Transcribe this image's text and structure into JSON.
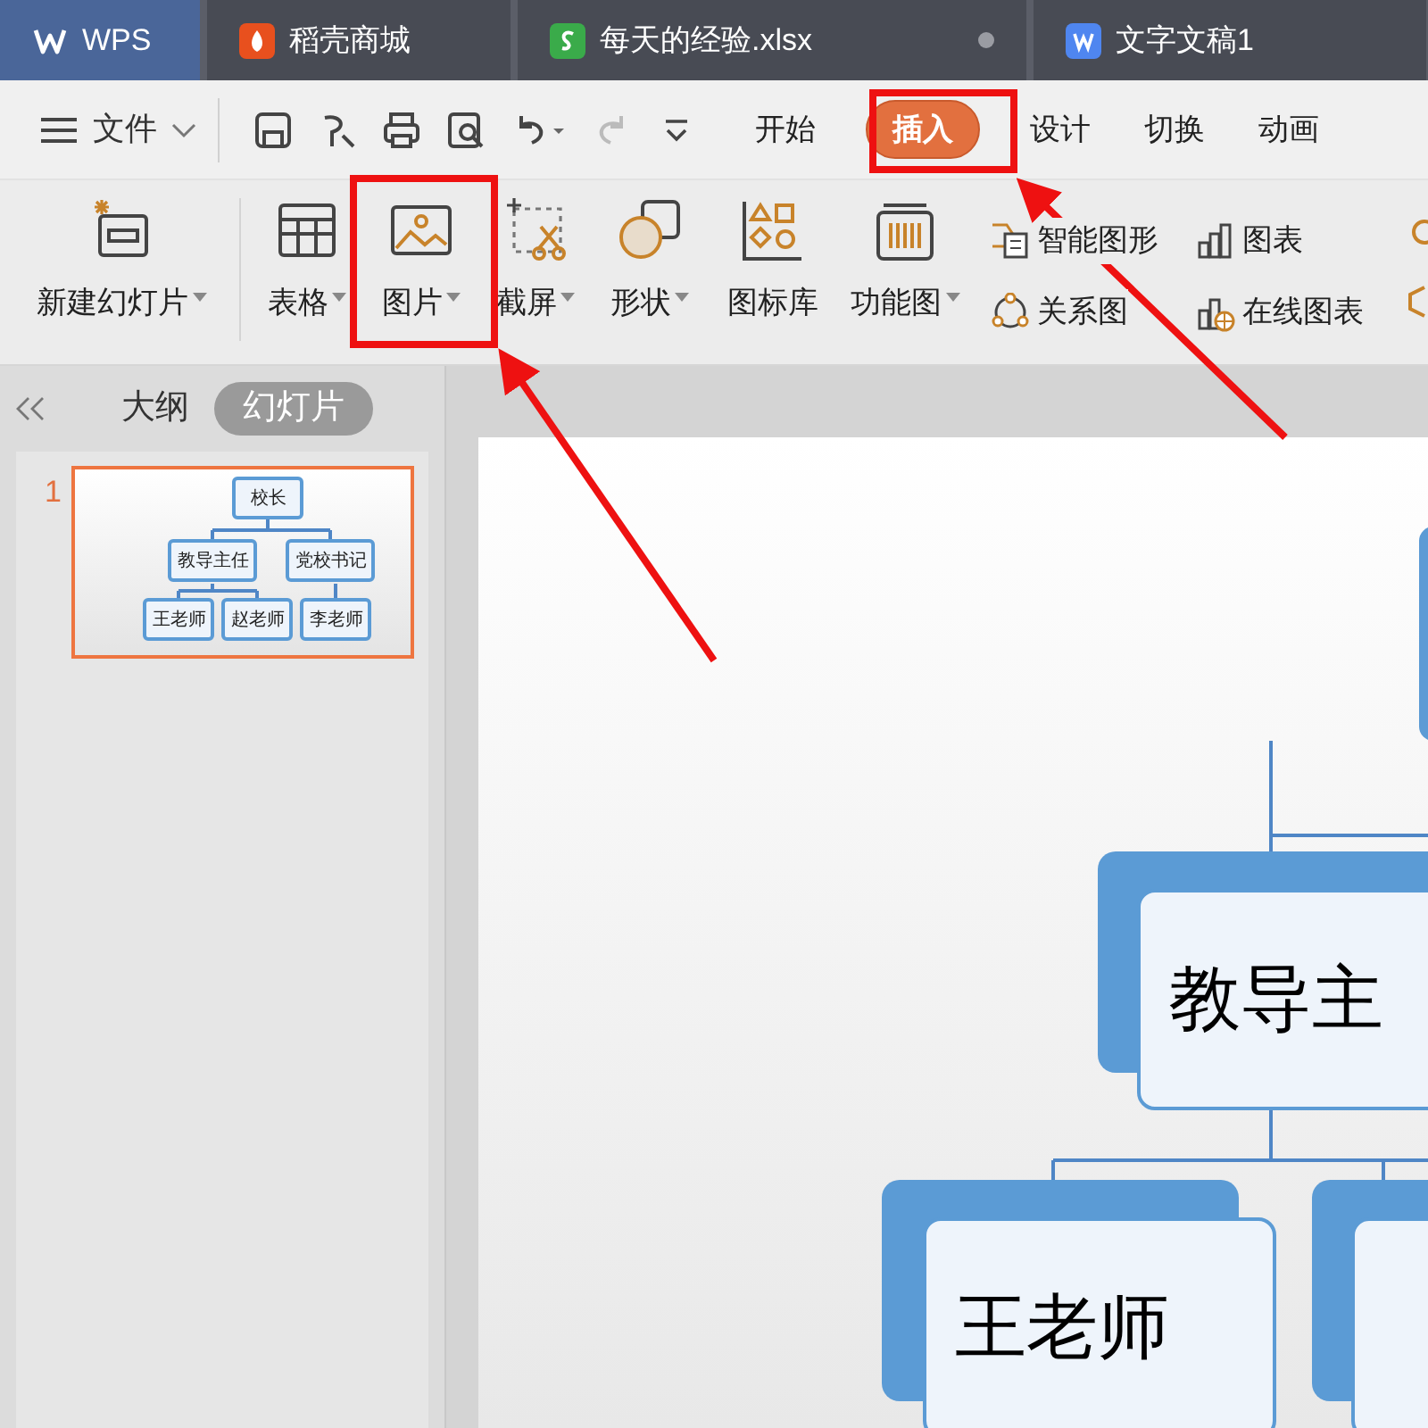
{
  "doc_tabs": [
    {
      "label": "WPS",
      "kind": "home",
      "selected": true
    },
    {
      "label": "稻壳商城",
      "kind": "store",
      "selected": false
    },
    {
      "label": "每天的经验.xlsx",
      "kind": "sheet",
      "selected": false,
      "unsaved": true
    },
    {
      "label": "文字文稿1",
      "kind": "doc",
      "selected": false
    }
  ],
  "file_menu": {
    "label": "文件"
  },
  "ribbon_tabs": [
    {
      "label": "开始",
      "selected": false
    },
    {
      "label": "插入",
      "selected": true
    },
    {
      "label": "设计",
      "selected": false
    },
    {
      "label": "切换",
      "selected": false
    },
    {
      "label": "动画",
      "selected": false
    }
  ],
  "ribbon_large": [
    {
      "label": "新建幻灯片",
      "kind": "new-slide",
      "dropdown": true
    },
    {
      "label": "表格",
      "kind": "table",
      "dropdown": true
    },
    {
      "label": "图片",
      "kind": "picture",
      "dropdown": true
    },
    {
      "label": "截屏",
      "kind": "screenshot",
      "dropdown": true
    },
    {
      "label": "形状",
      "kind": "shape",
      "dropdown": true
    },
    {
      "label": "图标库",
      "kind": "icons",
      "dropdown": false
    },
    {
      "label": "功能图",
      "kind": "function",
      "dropdown": true
    }
  ],
  "ribbon_small": [
    {
      "label": "智能图形",
      "kind": "smart"
    },
    {
      "label": "关系图",
      "kind": "relation"
    },
    {
      "label": "图表",
      "kind": "chart"
    },
    {
      "label": "在线图表",
      "kind": "online-chart"
    }
  ],
  "panel_tabs": [
    {
      "label": "大纲",
      "selected": false
    },
    {
      "label": "幻灯片",
      "selected": true
    }
  ],
  "slides": [
    {
      "number": "1",
      "selected": true,
      "nodes": [
        "校长",
        "教导主任",
        "党校书记",
        "王老师",
        "赵老师",
        "李老师"
      ]
    }
  ],
  "canvas_nodes": [
    "教导主",
    "王老师"
  ]
}
